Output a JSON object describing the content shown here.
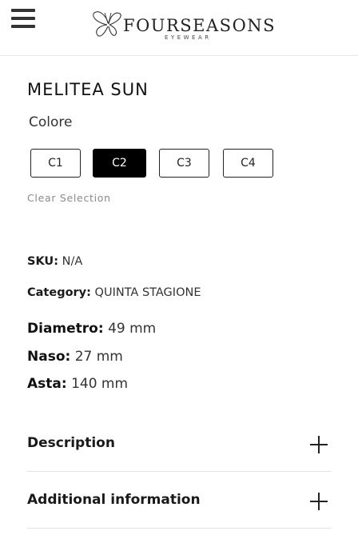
{
  "brand": {
    "name": "FOURSEASONS",
    "sub": "EYEWEAR"
  },
  "product": {
    "title": "MELITEA SUN",
    "color_label": "Colore",
    "colors": [
      "C1",
      "C2",
      "C3",
      "C4"
    ],
    "selected_color": "C2",
    "clear_selection": "Clear Selection",
    "sku": {
      "label": "SKU:",
      "value": "N/A"
    },
    "category": {
      "label": "Category:",
      "value": "QUINTA STAGIONE"
    },
    "specs": [
      {
        "label": "Diametro:",
        "value": "49 mm"
      },
      {
        "label": "Naso:",
        "value": "27 mm"
      },
      {
        "label": "Asta:",
        "value": "140 mm"
      }
    ]
  },
  "accordions": [
    {
      "label": "Description"
    },
    {
      "label": "Additional information"
    }
  ],
  "icons": {
    "menu": "hamburger-menu-icon",
    "logo": "butterfly-logo-icon",
    "expand": "plus-icon"
  }
}
